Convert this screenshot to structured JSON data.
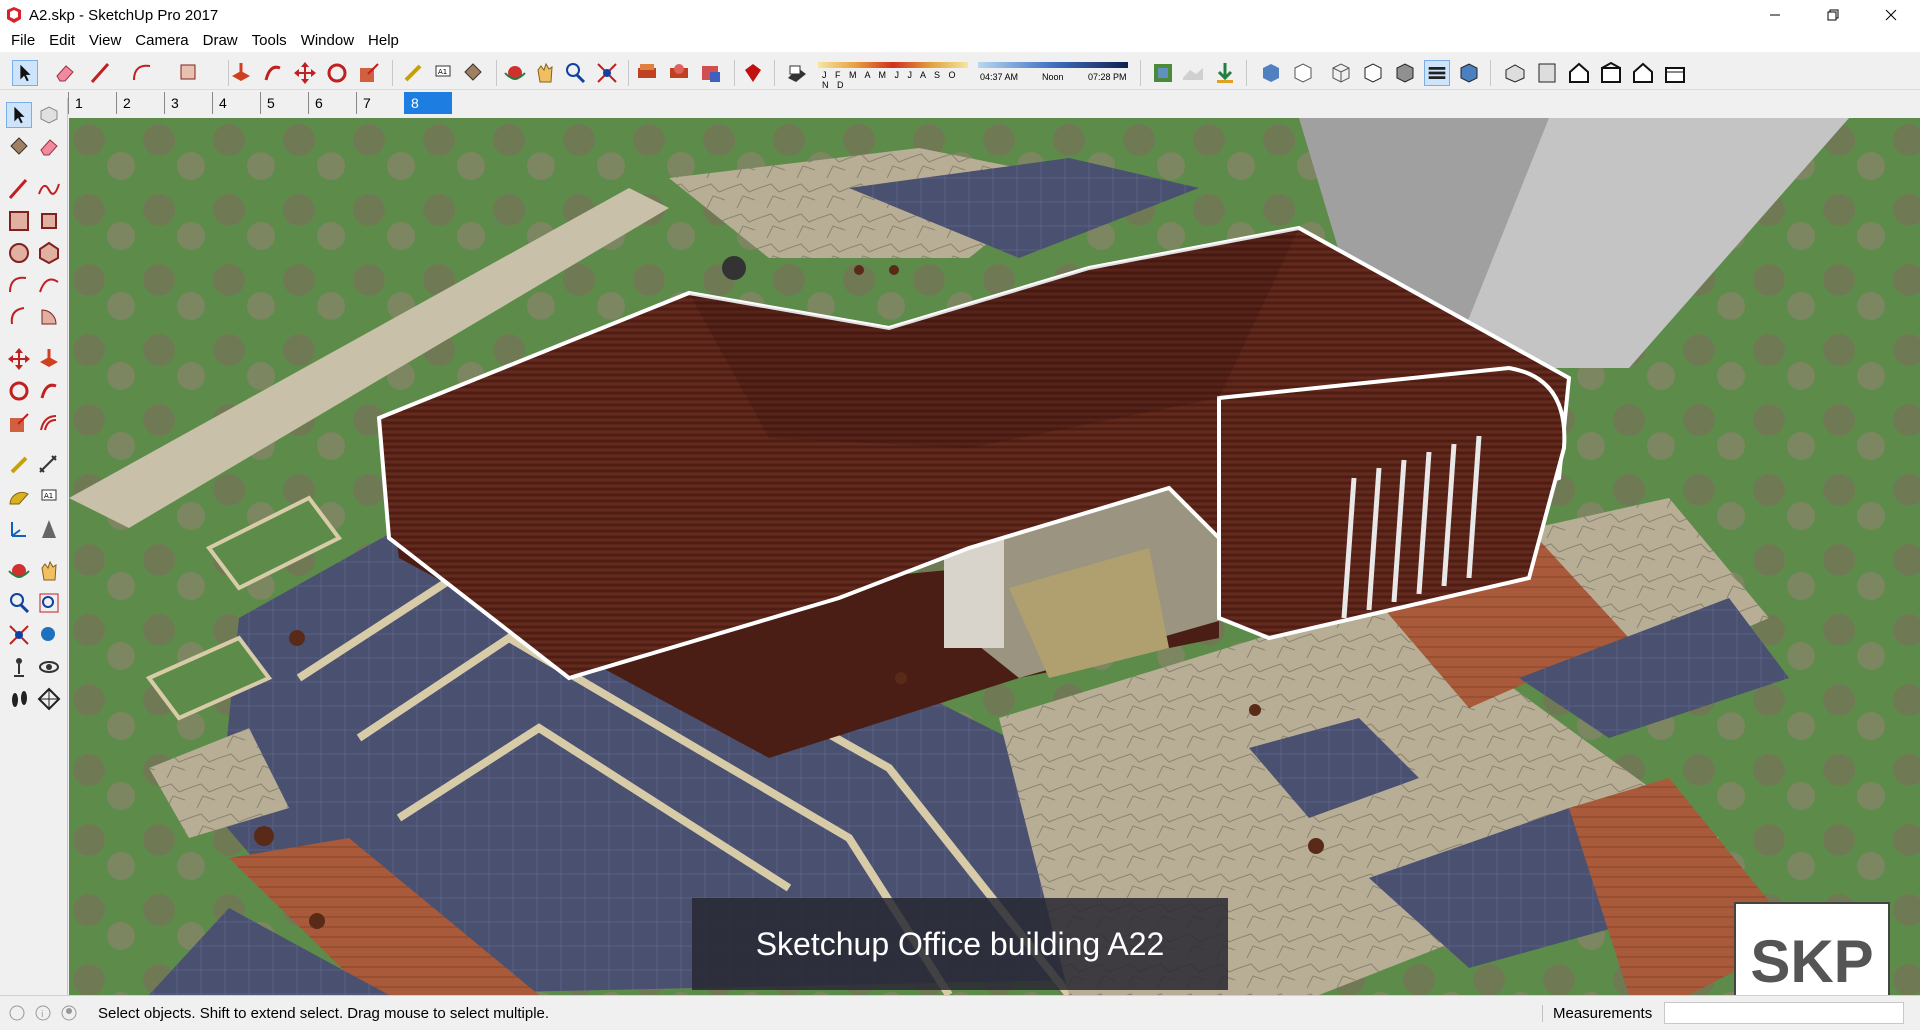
{
  "window": {
    "title": "A2.skp - SketchUp Pro 2017"
  },
  "menu": [
    "File",
    "Edit",
    "View",
    "Camera",
    "Draw",
    "Tools",
    "Window",
    "Help"
  ],
  "shadows": {
    "months": "J F M A M J J A S O N D",
    "time_start": "04:37 AM",
    "time_mid": "Noon",
    "time_end": "07:28 PM"
  },
  "scenes": [
    "1",
    "2",
    "3",
    "4",
    "5",
    "6",
    "7",
    "8"
  ],
  "active_scene": "8",
  "caption": "Sketchup Office building A22",
  "logo": "SKP",
  "status": {
    "hint": "Select objects. Shift to extend select. Drag mouse to select multiple.",
    "measurements_label": "Measurements",
    "measurements_value": ""
  },
  "colors": {
    "accent": "#1e7de0",
    "roof": "#5a2418",
    "lawn": "#5d8c4a",
    "paving": "#4a5070"
  }
}
